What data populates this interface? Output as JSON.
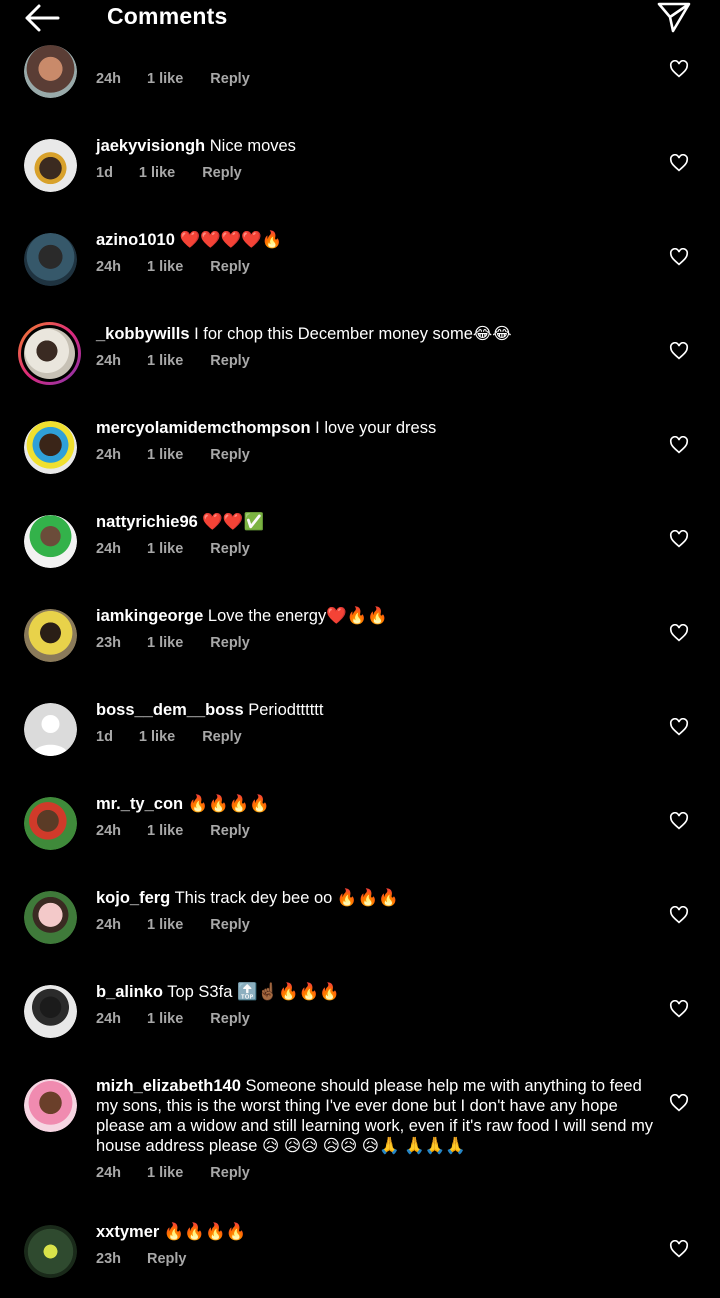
{
  "header": {
    "title": "Comments"
  },
  "comments": [
    {
      "username": "",
      "text": "",
      "time": "24h",
      "likes": "1 like",
      "reply": "Reply"
    },
    {
      "username": "jaekyvisiongh",
      "text": "Nice moves",
      "time": "1d",
      "likes": "1 like",
      "reply": "Reply"
    },
    {
      "username": "azino1010",
      "text": "❤️❤️❤️❤️🔥",
      "time": "24h",
      "likes": "1 like",
      "reply": "Reply"
    },
    {
      "username": "_kobbywills",
      "text": "I for chop this December money some😂😂",
      "time": "24h",
      "likes": "1 like",
      "reply": "Reply"
    },
    {
      "username": "mercyolamidemcthompson",
      "text": "I love your dress",
      "time": "24h",
      "likes": "1 like",
      "reply": "Reply"
    },
    {
      "username": "nattyrichie96",
      "text": "❤️❤️✅",
      "time": "24h",
      "likes": "1 like",
      "reply": "Reply"
    },
    {
      "username": "iamkingeorge",
      "text": "Love the energy❤️🔥🔥",
      "time": "23h",
      "likes": "1 like",
      "reply": "Reply"
    },
    {
      "username": "boss__dem__boss",
      "text": "Periodtttttt",
      "time": "1d",
      "likes": "1 like",
      "reply": "Reply"
    },
    {
      "username": "mr._ty_con",
      "text": "🔥🔥🔥🔥",
      "time": "24h",
      "likes": "1 like",
      "reply": "Reply"
    },
    {
      "username": "kojo_ferg",
      "text": "This track dey bee oo 🔥🔥🔥",
      "time": "24h",
      "likes": "1 like",
      "reply": "Reply"
    },
    {
      "username": "b_alinko",
      "text": "Top S3fa 🔝☝🏾🔥🔥🔥",
      "time": "24h",
      "likes": "1 like",
      "reply": "Reply"
    },
    {
      "username": "mizh_elizabeth140",
      "text": "Someone should please help me with anything to feed my sons, this is the worst thing I've ever done but I don't have any hope please am a widow and still learning work, even if it's raw food I will send my house address please 😥 😥😥 😥😥 😥🙏 🙏🙏🙏",
      "time": "24h",
      "likes": "1 like",
      "reply": "Reply"
    },
    {
      "username": "xxtymer",
      "text": "🔥🔥🔥🔥",
      "time": "23h",
      "likes": "",
      "reply": "Reply"
    }
  ],
  "colors": {
    "background": "#000000",
    "text": "#ffffff",
    "meta": "#a8a8a8"
  }
}
